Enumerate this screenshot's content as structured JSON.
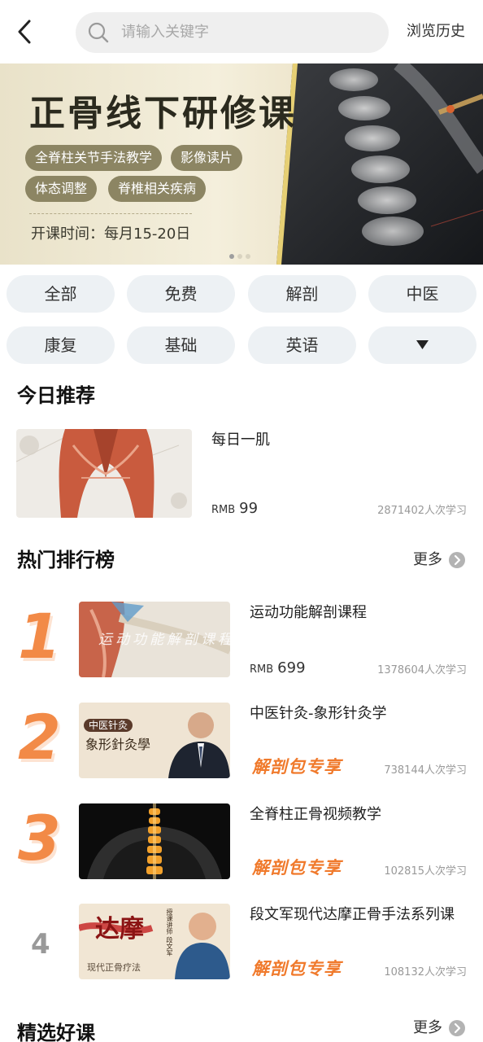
{
  "header": {
    "search_placeholder": "请输入关键字",
    "history_label": "浏览历史"
  },
  "banner": {
    "title": "正骨线下研修课",
    "tags": [
      "全脊柱关节手法教学",
      "影像读片",
      "体态调整",
      "脊椎相关疾病"
    ],
    "schedule": "开课时间：每月15-20日"
  },
  "categories": [
    "全部",
    "免费",
    "解剖",
    "中医",
    "康复",
    "基础",
    "英语"
  ],
  "today": {
    "heading": "今日推荐",
    "item": {
      "title": "每日一肌",
      "currency": "RMB",
      "price": "99",
      "learners": "2871402人次学习"
    }
  },
  "ranking": {
    "heading": "热门排行榜",
    "more_label": "更多",
    "items": [
      {
        "rank": "1",
        "title": "运动功能解剖课程",
        "currency": "RMB",
        "price": "699",
        "exclusive": "",
        "learners": "1378604人次学习",
        "thumb_text": "运动功能解剖课程"
      },
      {
        "rank": "2",
        "title": "中医针灸-象形针灸学",
        "currency": "",
        "price": "",
        "exclusive": "解剖包专享",
        "learners": "738144人次学习",
        "thumb_tag": "中医针灸",
        "thumb_text": "象形針灸學"
      },
      {
        "rank": "3",
        "title": "全脊柱正骨视频教学",
        "currency": "",
        "price": "",
        "exclusive": "解剖包专享",
        "learners": "102815人次学习"
      },
      {
        "rank": "4",
        "title": "段文军现代达摩正骨手法系列课",
        "currency": "",
        "price": "",
        "exclusive": "解剖包专享",
        "learners": "108132人次学习",
        "thumb_text": "达摩",
        "thumb_sub": "现代正骨疗法",
        "thumb_side": "授课讲师 段文军"
      }
    ]
  },
  "featured": {
    "heading": "精选好课",
    "more_label": "更多"
  },
  "colors": {
    "accent_orange": "#f07a2c",
    "pill_bg": "#edf1f4",
    "banner_chip": "#8c8563"
  }
}
